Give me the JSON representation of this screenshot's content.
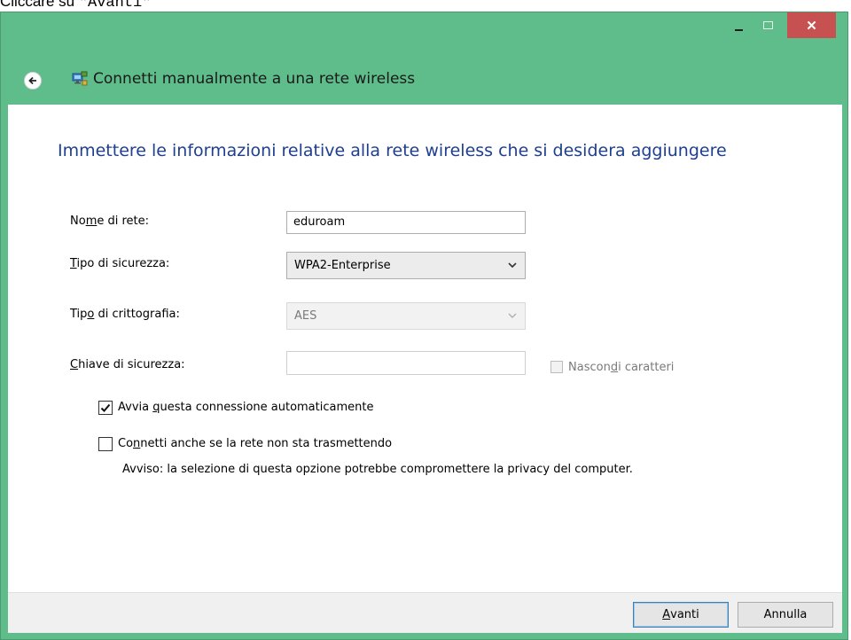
{
  "caption": {
    "prefix": "Cliccare su",
    "code": "\"Avanti\""
  },
  "window": {
    "controls": {
      "minimize": "",
      "maximize": "",
      "close": "✕"
    },
    "nav_title": "Connetti manualmente a una rete wireless"
  },
  "form": {
    "heading": "Immettere le informazioni relative alla rete wireless che si desidera aggiungere",
    "network_name": {
      "label_pre": "No",
      "label_u": "m",
      "label_post": "e di rete:",
      "value": "eduroam"
    },
    "security_type": {
      "label_pre": "",
      "label_u": "T",
      "label_post": "ipo di sicurezza:",
      "value": "WPA2-Enterprise"
    },
    "encryption_type": {
      "label_pre": "Tip",
      "label_u": "o",
      "label_post": " di crittografia:",
      "value": "AES"
    },
    "security_key": {
      "label_pre": "",
      "label_u": "C",
      "label_post": "hiave di sicurezza:",
      "value": ""
    },
    "hide_chars": {
      "label_pre": "Nascon",
      "label_u": "d",
      "label_post": "i caratteri",
      "checked": false,
      "enabled": false
    },
    "auto_start": {
      "label_pre": "Avvia ",
      "label_u": "q",
      "label_post": "uesta connessione automaticamente",
      "checked": true
    },
    "connect_hidden": {
      "label_pre": "Co",
      "label_u": "n",
      "label_post": "netti anche se la rete non sta trasmettendo",
      "checked": false
    },
    "warning": "Avviso: la selezione di questa opzione potrebbe compromettere la privacy del computer."
  },
  "footer": {
    "next": {
      "label_u": "A",
      "label_post": "vanti"
    },
    "cancel": "Annulla"
  }
}
